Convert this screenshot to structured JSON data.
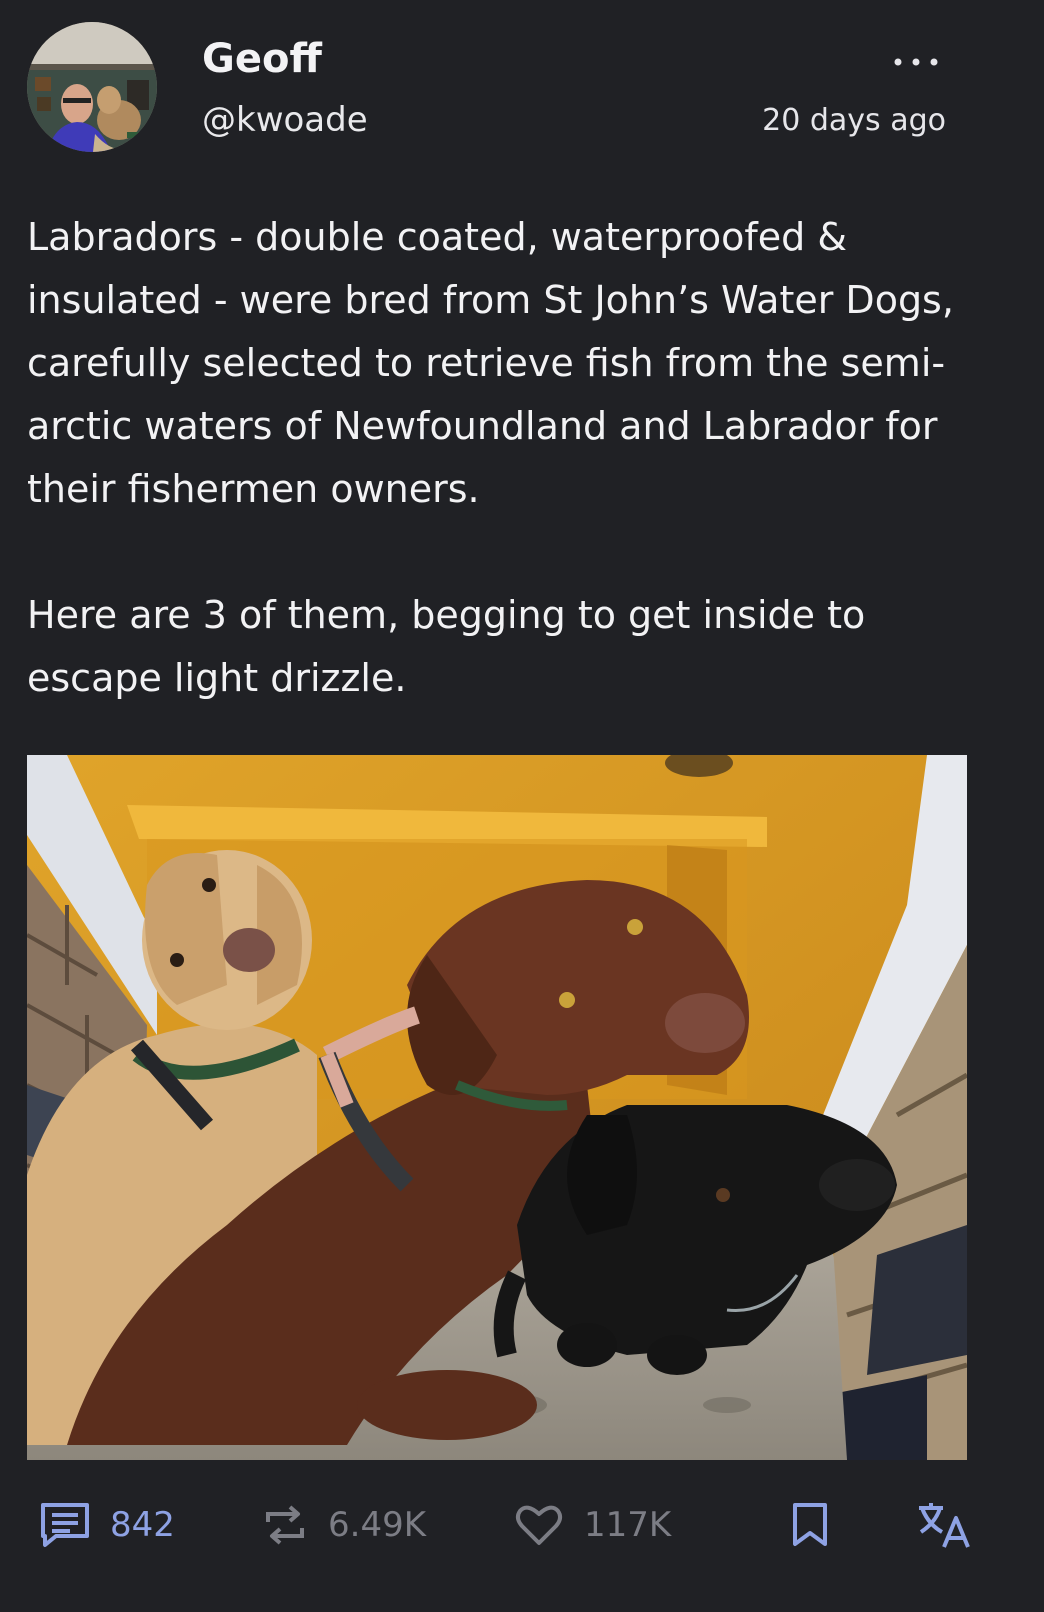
{
  "author": {
    "display_name": "Geoff",
    "handle": "@kwoade",
    "avatar_icon": "avatar-photo"
  },
  "post": {
    "timestamp": "20 days ago",
    "paragraphs": [
      "Labradors - double coated, waterproofed & insulated - were bred from St John’s Water Dogs, carefully selected to retrieve fish from the semi-arctic waters of Newfoundland and Labrador for their fishermen owners.",
      "Here are 3 of them, begging to get inside to escape light drizzle."
    ],
    "media": {
      "kind": "photo",
      "subject": "three labradors (yellow, chocolate, black) in front of a yellow door"
    }
  },
  "actions": {
    "reply": {
      "icon": "reply-icon",
      "count": "842"
    },
    "boost": {
      "icon": "boost-icon",
      "count": "6.49K"
    },
    "favourite": {
      "icon": "heart-icon",
      "count": "117K"
    },
    "bookmark": {
      "icon": "bookmark-icon"
    },
    "translate": {
      "icon": "translate-icon"
    }
  },
  "colors": {
    "background": "#202125",
    "text": "#f2f2f4",
    "accent": "#8ea2e4",
    "muted": "#7c7d85"
  }
}
